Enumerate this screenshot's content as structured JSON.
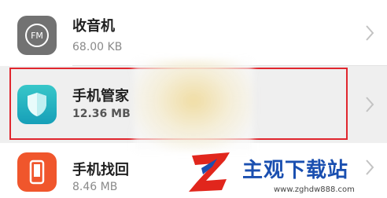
{
  "apps": [
    {
      "name": "收音机",
      "size": "68.00 KB",
      "icon": "radio-fm-icon"
    },
    {
      "name": "手机管家",
      "size": "12.36 MB",
      "icon": "shield-icon"
    },
    {
      "name": "手机找回",
      "size": "8.46 MB",
      "icon": "phone-finder-icon"
    }
  ],
  "radio_icon_text": "FM",
  "watermark": {
    "text": "主观下载站",
    "url": "www.zghdw888.com"
  },
  "colors": {
    "highlight": "#e0262e",
    "manager_teal": "#1ab0bf",
    "finder_orange": "#f0562c"
  }
}
